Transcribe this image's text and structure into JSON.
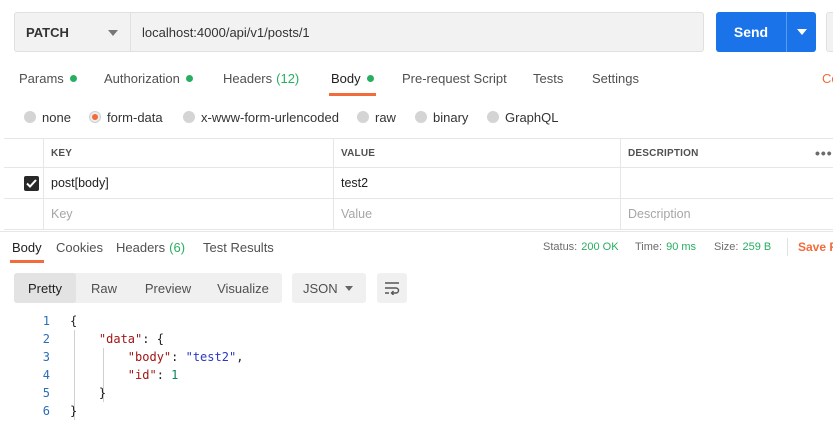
{
  "request": {
    "method": "PATCH",
    "url": "localhost:4000/api/v1/posts/1",
    "send_label": "Send"
  },
  "request_tabs": [
    {
      "label": "Params",
      "dot": true
    },
    {
      "label": "Authorization",
      "dot": true
    },
    {
      "label": "Headers",
      "count": "(12)"
    },
    {
      "label": "Body",
      "dot": true,
      "active": true
    },
    {
      "label": "Pre-request Script"
    },
    {
      "label": "Tests"
    },
    {
      "label": "Settings"
    }
  ],
  "cookies_stub": "Co",
  "body_types": [
    {
      "label": "none"
    },
    {
      "label": "form-data",
      "checked": true
    },
    {
      "label": "x-www-form-urlencoded"
    },
    {
      "label": "raw"
    },
    {
      "label": "binary"
    },
    {
      "label": "GraphQL"
    }
  ],
  "params_table": {
    "headers": [
      "KEY",
      "VALUE",
      "DESCRIPTION"
    ],
    "more": "•••",
    "rows": [
      {
        "checked": true,
        "key": "post[body]",
        "value": "test2",
        "description": ""
      }
    ],
    "placeholders": {
      "key": "Key",
      "value": "Value",
      "description": "Description"
    }
  },
  "response_tabs": [
    {
      "label": "Body",
      "active": true
    },
    {
      "label": "Cookies"
    },
    {
      "label": "Headers",
      "count": "(6)"
    },
    {
      "label": "Test Results"
    }
  ],
  "response_meta": {
    "status_label": "Status:",
    "status_value": "200 OK",
    "time_label": "Time:",
    "time_value": "90 ms",
    "size_label": "Size:",
    "size_value": "259 B",
    "save_label": "Save R"
  },
  "view_modes": [
    "Pretty",
    "Raw",
    "Preview",
    "Visualize"
  ],
  "active_view": "Pretty",
  "format": "JSON",
  "code_lines": [
    {
      "n": "1"
    },
    {
      "n": "2",
      "key": "\"data\"",
      "rest": ": {"
    },
    {
      "n": "3",
      "key": "\"body\"",
      "val": "\"test2\"",
      "tail": ","
    },
    {
      "n": "4",
      "key": "\"id\"",
      "num": "1"
    },
    {
      "n": "5"
    },
    {
      "n": "6"
    }
  ],
  "colors": {
    "accent": "#f26b3a",
    "send": "#1a73e8",
    "ok": "#27ae60"
  }
}
